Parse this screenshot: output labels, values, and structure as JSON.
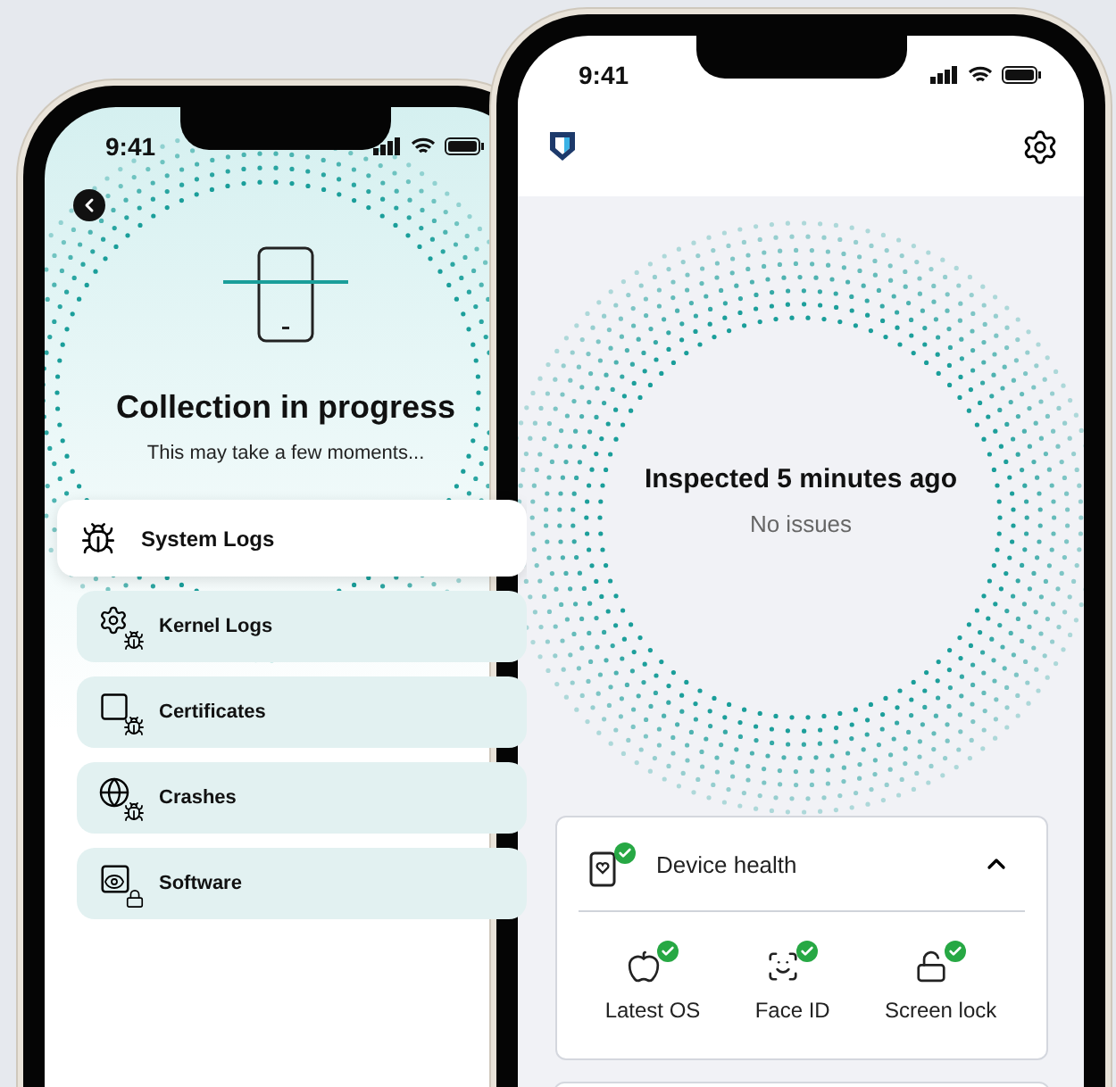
{
  "left_phone": {
    "time": "9:41",
    "title": "Collection in progress",
    "subtitle": "This may take a few moments...",
    "items": [
      {
        "label": "System Logs",
        "selected": true
      },
      {
        "label": "Kernel Logs",
        "selected": false
      },
      {
        "label": "Certificates",
        "selected": false
      },
      {
        "label": "Crashes",
        "selected": false
      },
      {
        "label": "Software",
        "selected": false
      }
    ]
  },
  "right_phone": {
    "time": "9:41",
    "status_title": "Inspected 5 minutes ago",
    "status_subtitle": "No issues",
    "card": {
      "title": "Device health",
      "checked": true,
      "expanded": true,
      "checks": [
        {
          "label": "Latest OS",
          "checked": true
        },
        {
          "label": "Face ID",
          "checked": true
        },
        {
          "label": "Screen lock",
          "checked": true
        }
      ]
    }
  }
}
